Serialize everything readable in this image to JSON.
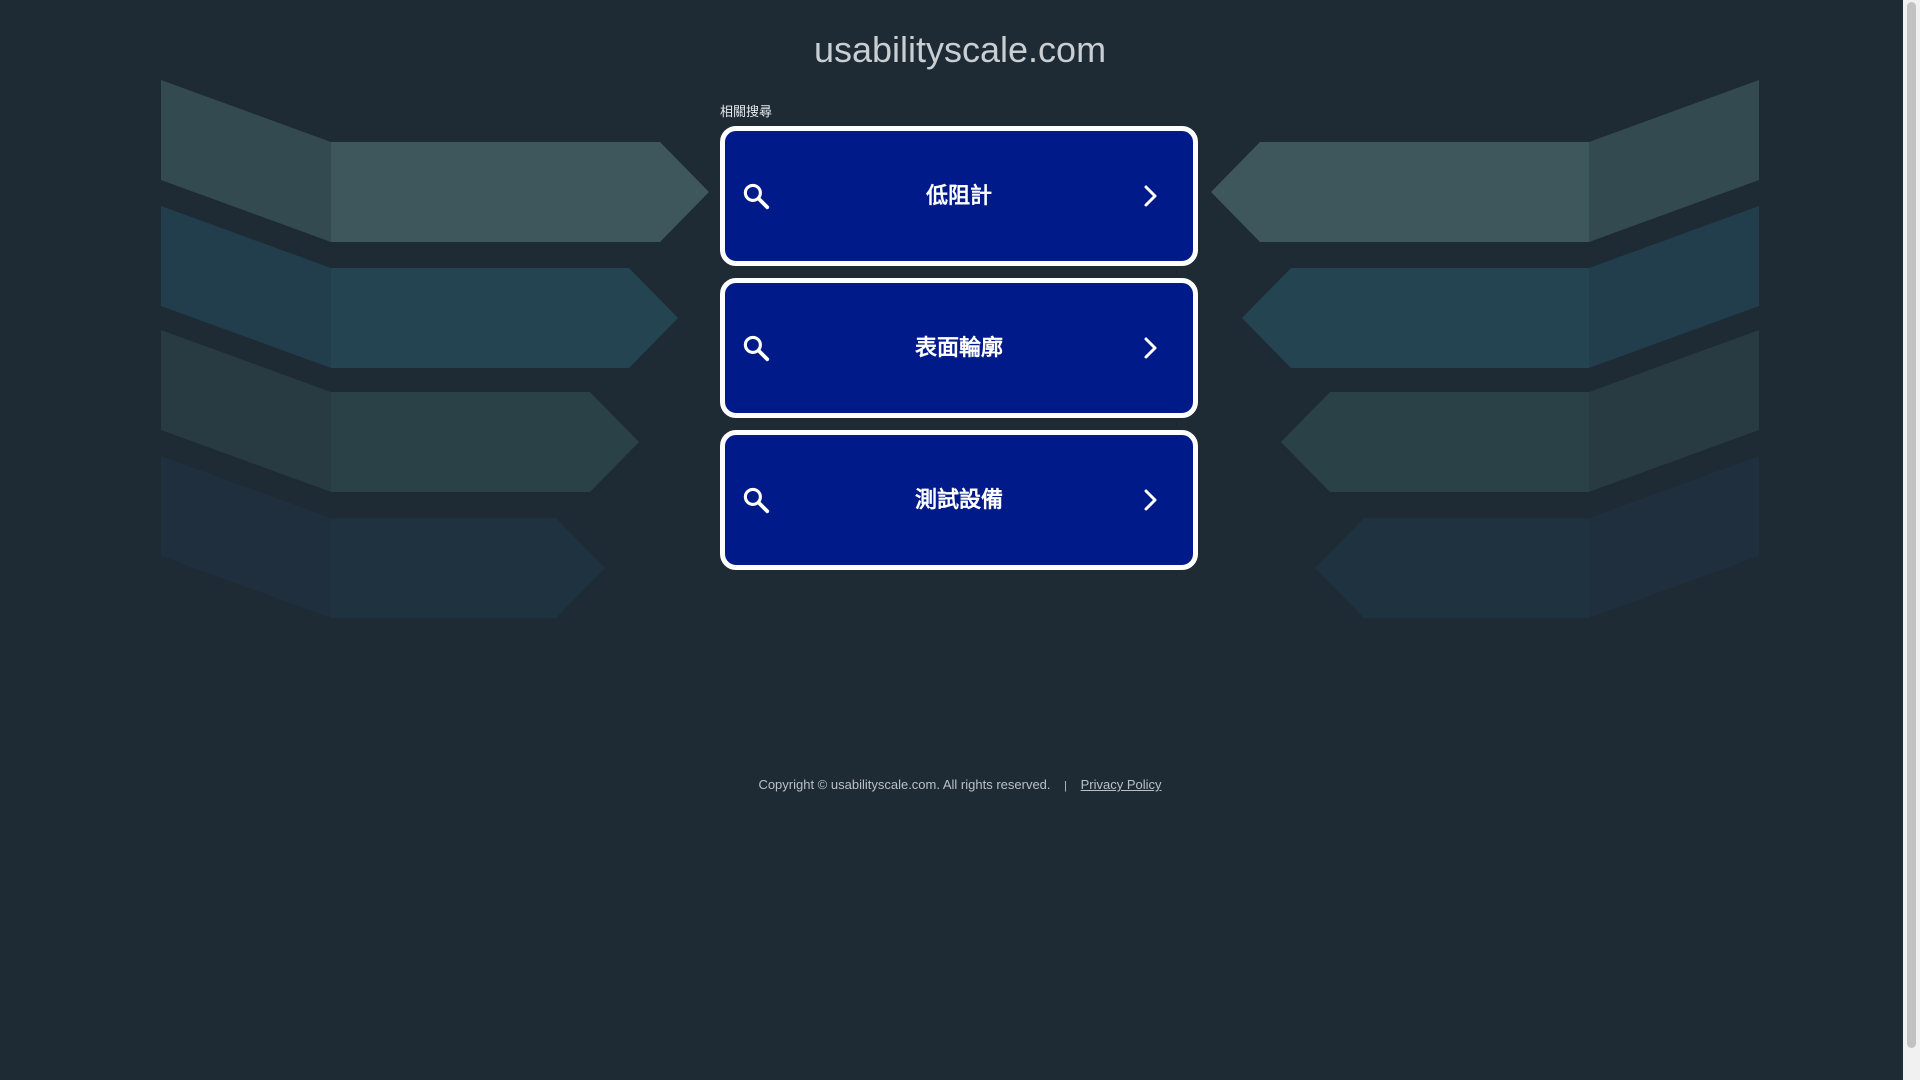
{
  "site": {
    "domain": "usabilityscale.com"
  },
  "related": {
    "label": "相關搜尋",
    "items": [
      {
        "label": "低阻計"
      },
      {
        "label": "表面輪廓"
      },
      {
        "label": "測試設備"
      }
    ]
  },
  "footer": {
    "copyright": "Copyright © usabilityscale.com.  All rights reserved.",
    "separator": "|",
    "privacy_label": "Privacy Policy"
  },
  "icons": {
    "search": "search-icon",
    "chevron": "chevron-right-icon"
  },
  "colors": {
    "background": "#1e2a34",
    "button_fill": "#011a8a",
    "button_border": "#ffffff"
  }
}
